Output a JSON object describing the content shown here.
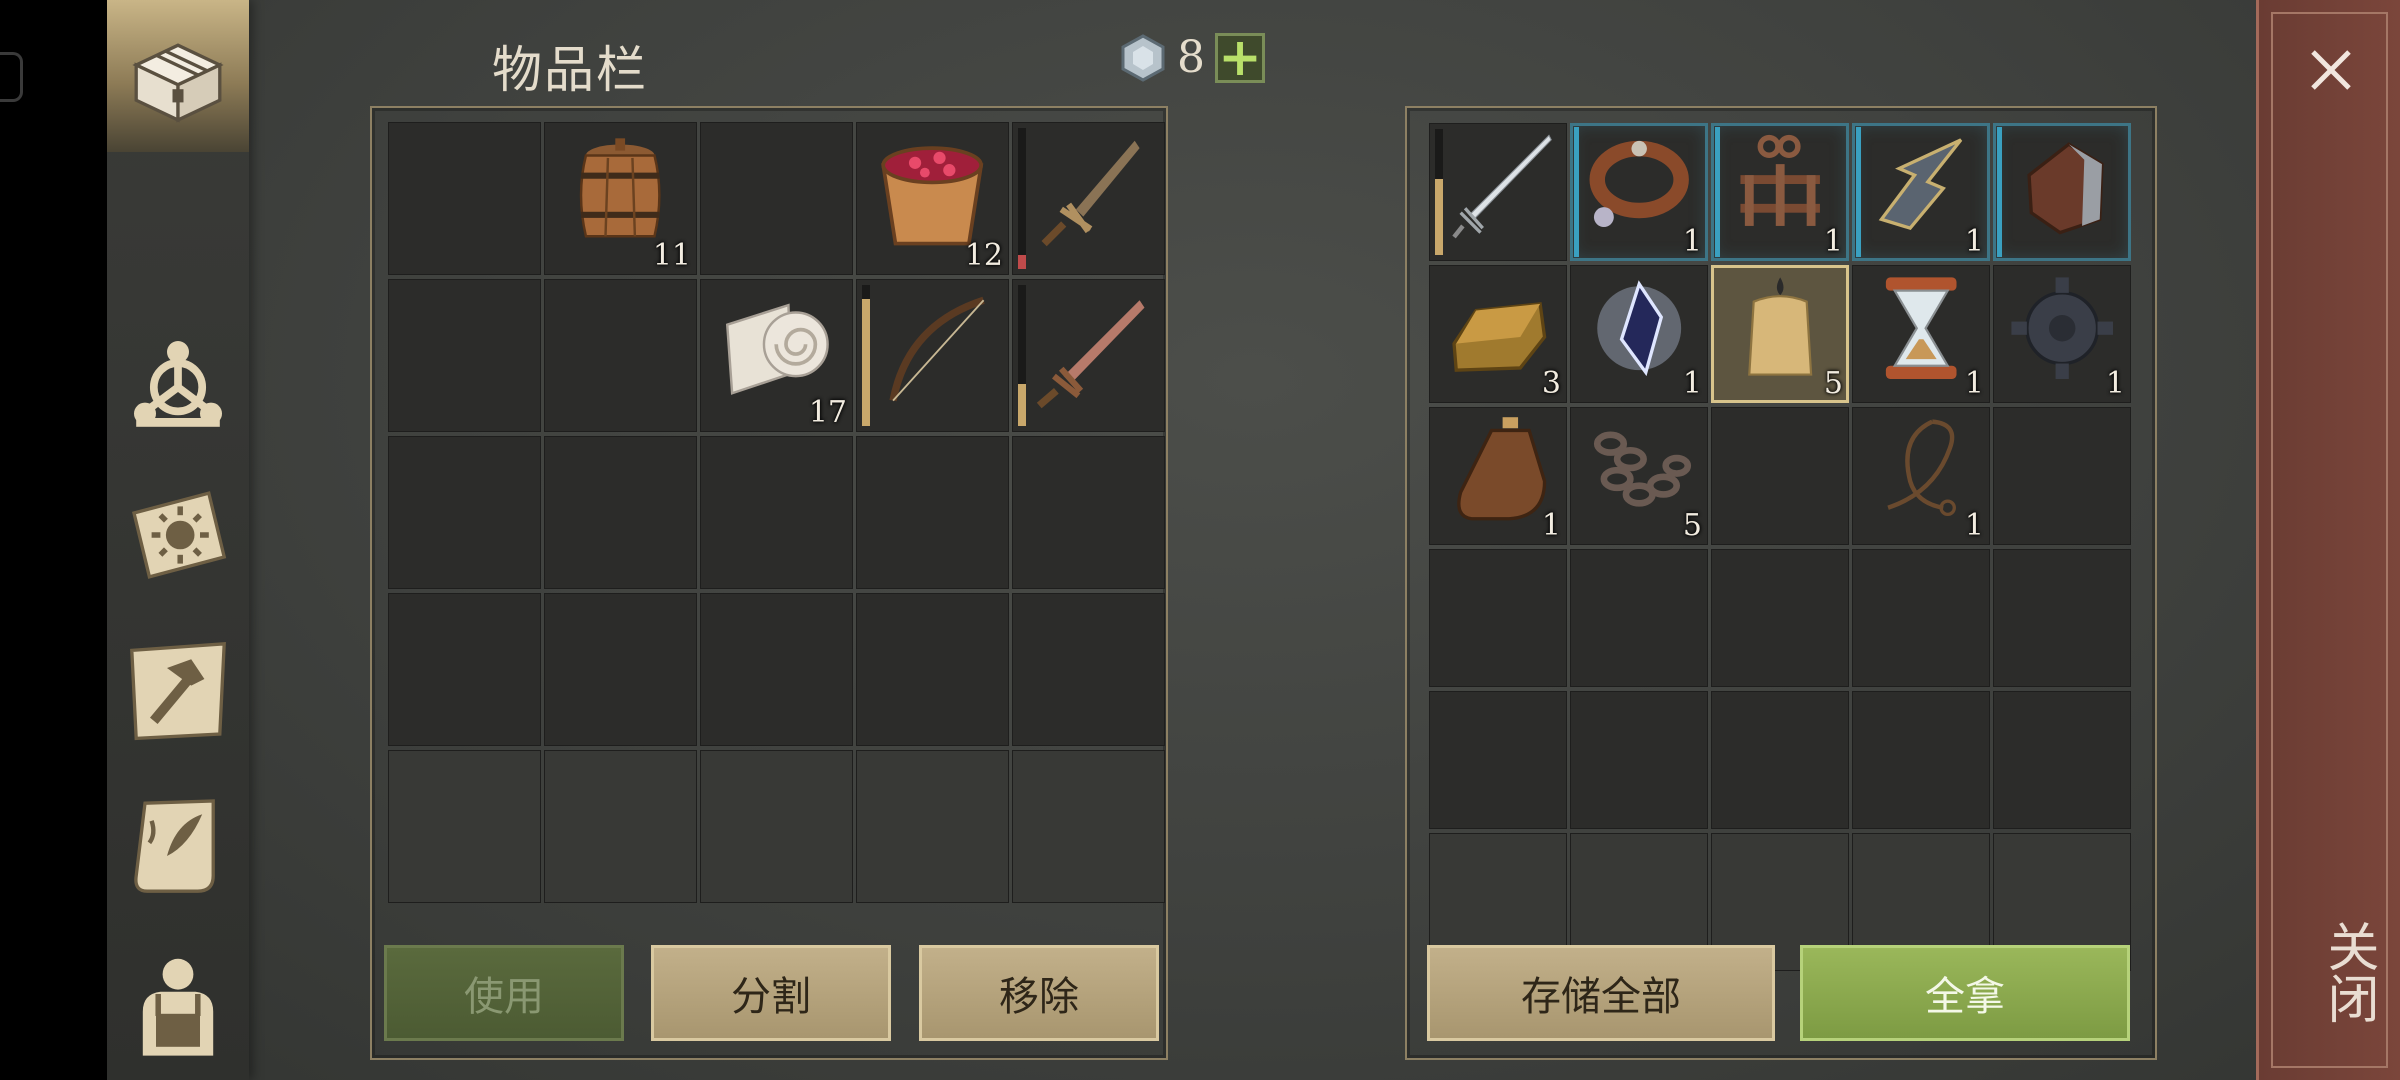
{
  "inventory": {
    "title": "物品栏",
    "gem_count": "8",
    "plus_label": "+",
    "slots": [
      {
        "icon": "empty-slot"
      },
      {
        "icon": "wooden-barrel-icon",
        "qty": "11"
      },
      {
        "icon": "empty-slot"
      },
      {
        "icon": "berry-bucket-icon",
        "qty": "12"
      },
      {
        "icon": "short-sword-icon",
        "durability": 0.1,
        "durability_color": "#c04b4b"
      },
      {
        "icon": "empty-slot"
      },
      {
        "icon": "empty-slot"
      },
      {
        "icon": "cloth-roll-icon",
        "qty": "17"
      },
      {
        "icon": "bow-icon",
        "durability": 0.9
      },
      {
        "icon": "copper-sword-icon",
        "durability": 0.3
      }
    ],
    "buttons": {
      "use": "使用",
      "split": "分割",
      "remove": "移除"
    }
  },
  "container": {
    "slots": [
      {
        "icon": "long-sword-icon",
        "durability": 0.6
      },
      {
        "icon": "leather-collar-icon",
        "qty": "1",
        "equip": true
      },
      {
        "icon": "shackles-icon",
        "qty": "1",
        "equip": true
      },
      {
        "icon": "boomerang-blade-icon",
        "qty": "1",
        "equip": true
      },
      {
        "icon": "gauntlet-icon",
        "equip": true
      },
      {
        "icon": "gold-ingot-icon",
        "qty": "3"
      },
      {
        "icon": "crystal-shard-icon",
        "qty": "1"
      },
      {
        "icon": "candle-icon",
        "qty": "5",
        "highlight": true
      },
      {
        "icon": "hourglass-icon",
        "qty": "1"
      },
      {
        "icon": "gear-icon",
        "qty": "1"
      },
      {
        "icon": "leather-flask-icon",
        "qty": "1"
      },
      {
        "icon": "iron-chain-icon",
        "qty": "5"
      },
      {
        "icon": "empty-slot"
      },
      {
        "icon": "rope-whip-icon",
        "qty": "1"
      },
      {
        "icon": "empty-slot"
      }
    ],
    "buttons": {
      "store_all": "存储全部",
      "take_all": "全拿"
    }
  },
  "sidebar": {
    "tabs": [
      {
        "icon": "treasure-chest-icon",
        "active": true
      },
      {
        "icon": "skill-tree-icon"
      },
      {
        "icon": "sun-book-icon"
      },
      {
        "icon": "crafting-hammer-icon"
      },
      {
        "icon": "quest-scroll-icon"
      },
      {
        "icon": "character-backpack-icon"
      }
    ]
  },
  "close": {
    "label": "关闭"
  },
  "colors": {
    "accent_tan": "#c2b08a",
    "accent_green": "#9ab75a",
    "close_red": "#7b463b",
    "equip_blue": "#3d7586"
  }
}
